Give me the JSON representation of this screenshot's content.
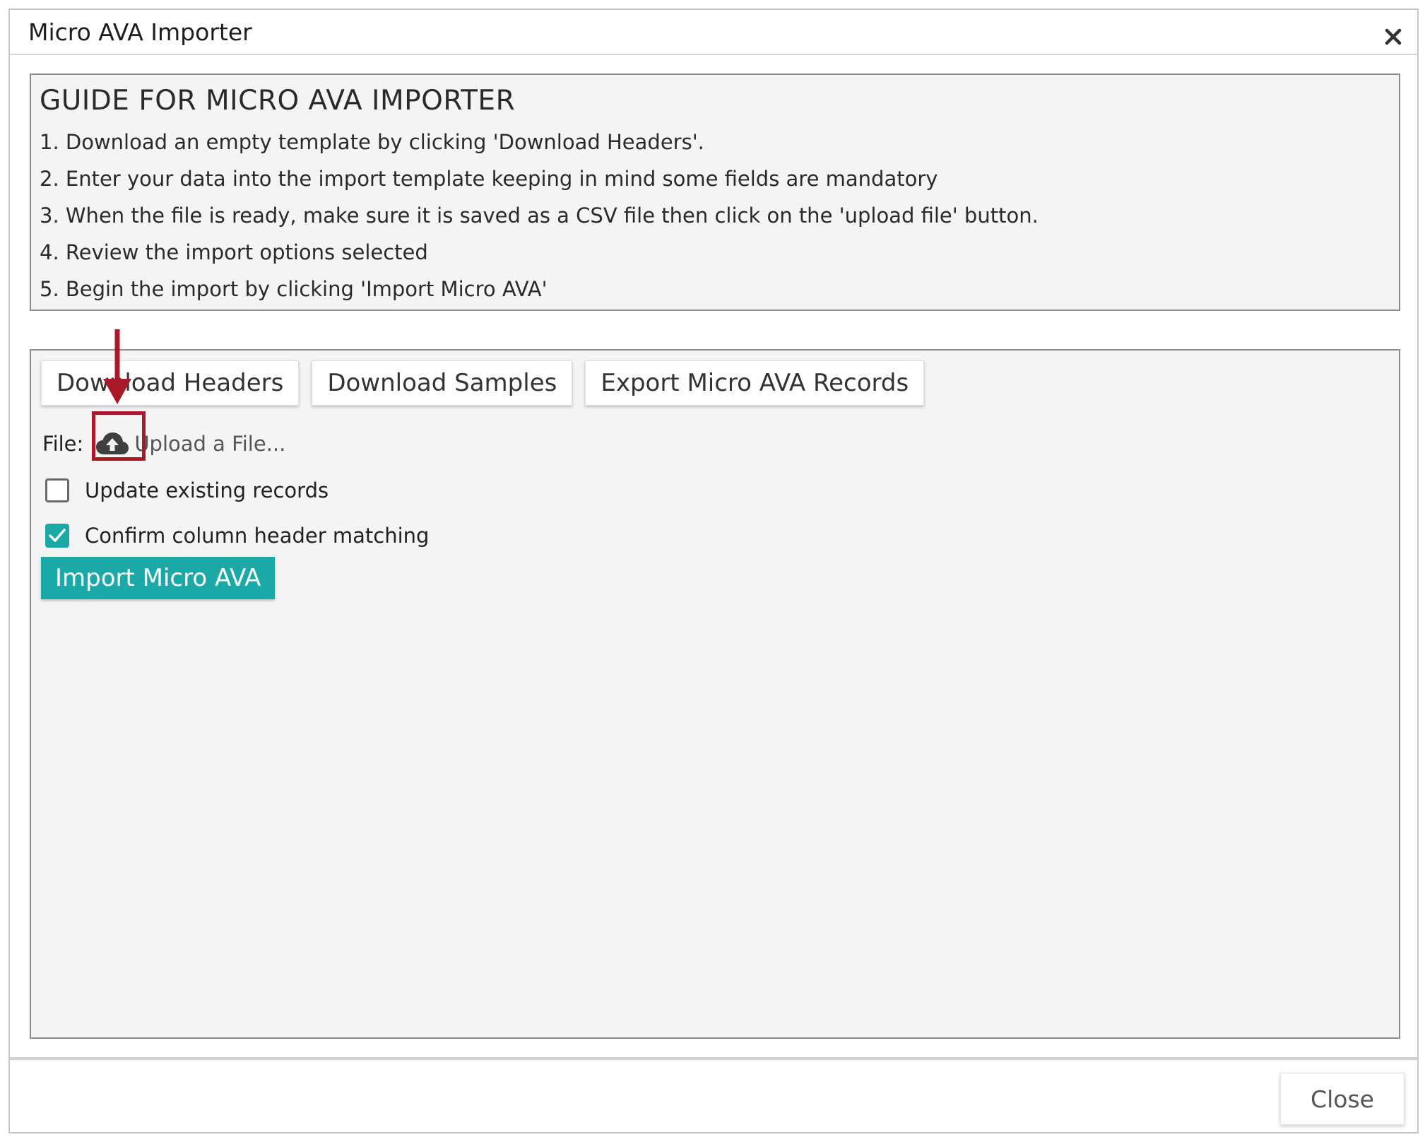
{
  "dialog": {
    "title": "Micro AVA Importer",
    "close_icon": "close-icon"
  },
  "guide": {
    "heading": "GUIDE FOR MICRO AVA IMPORTER",
    "steps": [
      "1. Download an empty template by clicking 'Download Headers'.",
      "2. Enter your data into the import template keeping in mind some fields are mandatory",
      "3. When the file is ready, make sure it is saved as a CSV file then click on the 'upload file' button.",
      "4. Review the import options selected",
      "5. Begin the import by clicking 'Import Micro AVA'"
    ]
  },
  "toolbar": {
    "download_headers": "Download Headers",
    "download_samples": "Download Samples",
    "export_records": "Export Micro AVA Records"
  },
  "file": {
    "label": "File:",
    "upload_icon": "cloud-upload-icon",
    "upload_text": "Upload a File..."
  },
  "options": {
    "update_existing": {
      "label": "Update existing records",
      "checked": false
    },
    "confirm_matching": {
      "label": "Confirm column header matching",
      "checked": true
    }
  },
  "actions": {
    "import_label": "Import Micro AVA",
    "close_label": "Close"
  },
  "colors": {
    "accent": "#1aa9a6",
    "annotation": "#a8192a"
  }
}
